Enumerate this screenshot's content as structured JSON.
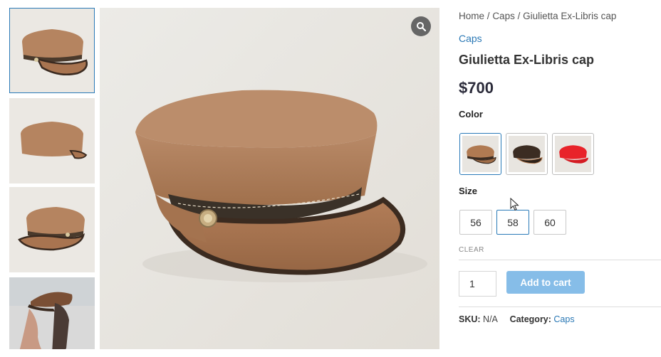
{
  "breadcrumb": {
    "home": "Home",
    "sep1": "/",
    "category": "Caps",
    "sep2": "/",
    "current": "Giulietta Ex-Libris cap"
  },
  "product": {
    "category_link": "Caps",
    "title": "Giulietta Ex-Libris cap",
    "price": "$700"
  },
  "gallery": {
    "thumbnails": [
      {
        "label": "cap-side-view",
        "active": true
      },
      {
        "label": "cap-back-view",
        "active": false
      },
      {
        "label": "cap-three-quarter-view",
        "active": false
      },
      {
        "label": "model-wearing-cap",
        "active": false
      }
    ],
    "zoom_icon": "magnifier-icon"
  },
  "options": {
    "color_label": "Color",
    "colors": [
      {
        "name": "tan",
        "hex": "#b07a52",
        "selected": true
      },
      {
        "name": "dark-brown",
        "hex": "#3b2c22",
        "selected": false
      },
      {
        "name": "red",
        "hex": "#e8232a",
        "selected": false
      }
    ],
    "size_label": "Size",
    "sizes": [
      {
        "label": "56",
        "selected": false
      },
      {
        "label": "58",
        "selected": true
      },
      {
        "label": "60",
        "selected": false
      }
    ],
    "clear_label": "CLEAR"
  },
  "cart": {
    "quantity": "1",
    "add_label": "Add to cart"
  },
  "meta": {
    "sku_label": "SKU:",
    "sku_value": "N/A",
    "category_label": "Category:",
    "category_value": "Caps"
  },
  "colors": {
    "link": "#2a78b5",
    "selected_border": "#2a7ab8",
    "button_bg": "#86bde8"
  }
}
